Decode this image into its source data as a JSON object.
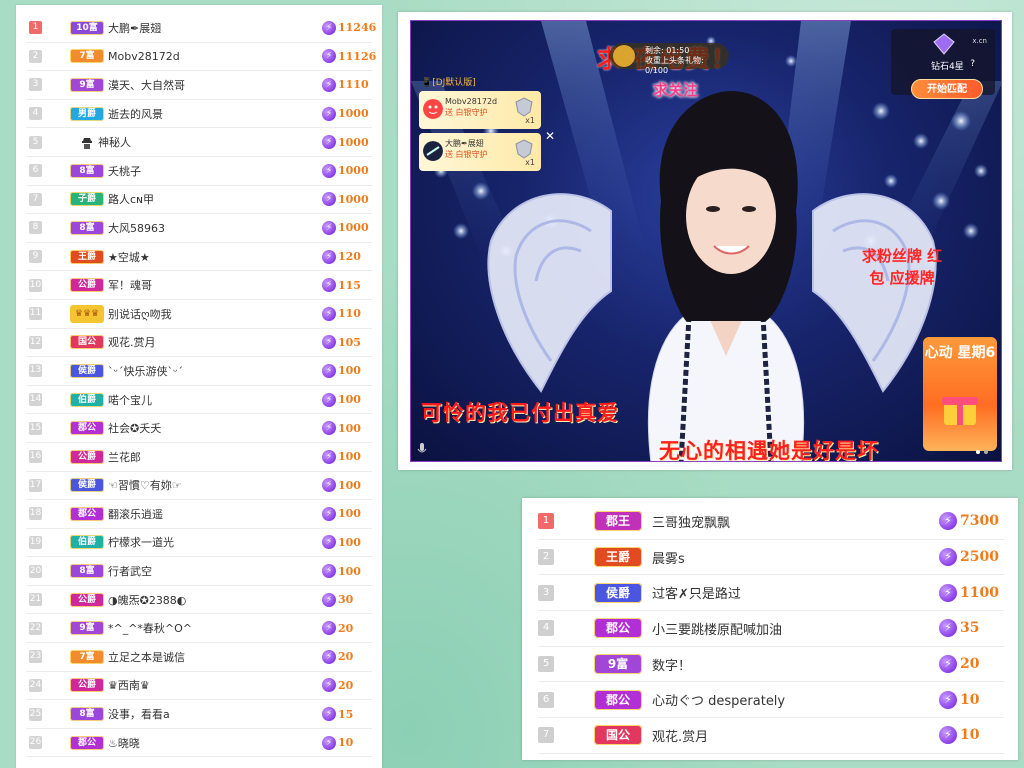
{
  "left_ranking": {
    "rows": [
      {
        "rank": "1",
        "badge": "10富",
        "badge_color": "#8a49d8",
        "name": "大鹏✒展翅",
        "value": "11246",
        "top": true
      },
      {
        "rank": "2",
        "badge": "7富",
        "badge_color": "#f28a2e",
        "name": "Mobv28172d",
        "value": "11126"
      },
      {
        "rank": "3",
        "badge": "9富",
        "badge_color": "#a246d8",
        "name": "漠天、大自然哥",
        "value": "1110"
      },
      {
        "rank": "4",
        "badge": "男爵",
        "badge_color": "#22a7e0",
        "name": "逝去的风景",
        "value": "1000"
      },
      {
        "rank": "5",
        "badge": "",
        "badge_color": "",
        "name": "神秘人",
        "value": "1000",
        "mystery": true
      },
      {
        "rank": "6",
        "badge": "8富",
        "badge_color": "#9b47dc",
        "name": "夭桃子",
        "value": "1000"
      },
      {
        "rank": "7",
        "badge": "子爵",
        "badge_color": "#27b37a",
        "name": "路人ᴄɴ甲",
        "value": "1000"
      },
      {
        "rank": "8",
        "badge": "8富",
        "badge_color": "#9b47dc",
        "name": "大风58963",
        "value": "1000"
      },
      {
        "rank": "9",
        "badge": "王爵",
        "badge_color": "#e24a1f",
        "name": "★空城★",
        "value": "120"
      },
      {
        "rank": "10",
        "badge": "公爵",
        "badge_color": "#d0289a",
        "name": "军！魂哥",
        "value": "115"
      },
      {
        "rank": "11",
        "badge": "",
        "badge_color": "",
        "name": "别说话ღ吻我",
        "value": "110",
        "crown": true
      },
      {
        "rank": "12",
        "badge": "国公",
        "badge_color": "#e23860",
        "name": "观花.赏月",
        "value": "105"
      },
      {
        "rank": "13",
        "badge": "侯爵",
        "badge_color": "#4a55e0",
        "name": "ˋᵕˊ快乐游侠ˋᵕˊ",
        "value": "100"
      },
      {
        "rank": "14",
        "badge": "伯爵",
        "badge_color": "#1fb0a8",
        "name": "喏个宝儿",
        "value": "100"
      },
      {
        "rank": "15",
        "badge": "郡公",
        "badge_color": "#b22fd6",
        "name": "社会✪夭夭",
        "value": "100"
      },
      {
        "rank": "16",
        "badge": "公爵",
        "badge_color": "#d0289a",
        "name": "兰花郎",
        "value": "100"
      },
      {
        "rank": "17",
        "badge": "侯爵",
        "badge_color": "#4a55e0",
        "name": "☜習慣♡有妳☞",
        "value": "100"
      },
      {
        "rank": "18",
        "badge": "郡公",
        "badge_color": "#b22fd6",
        "name": "翻滚乐逍遥",
        "value": "100"
      },
      {
        "rank": "19",
        "badge": "伯爵",
        "badge_color": "#1fb0a8",
        "name": "柠檬求一道光",
        "value": "100"
      },
      {
        "rank": "20",
        "badge": "8富",
        "badge_color": "#9b47dc",
        "name": "行者武空",
        "value": "100"
      },
      {
        "rank": "21",
        "badge": "公爵",
        "badge_color": "#d0289a",
        "name": "◑魄炁✪2388◐",
        "value": "30"
      },
      {
        "rank": "22",
        "badge": "9富",
        "badge_color": "#a246d8",
        "name": "*^_^*春秋^O^",
        "value": "20"
      },
      {
        "rank": "23",
        "badge": "7富",
        "badge_color": "#f28a2e",
        "name": "立足之本是诚信",
        "value": "20"
      },
      {
        "rank": "24",
        "badge": "公爵",
        "badge_color": "#d0289a",
        "name": "♛西南♛",
        "value": "20"
      },
      {
        "rank": "25",
        "badge": "8富",
        "badge_color": "#9b47dc",
        "name": "没事，看看a",
        "value": "15"
      },
      {
        "rank": "26",
        "badge": "郡公",
        "badge_color": "#b22fd6",
        "name": "♨晓晓",
        "value": "10"
      }
    ]
  },
  "stream": {
    "title_banner": "求   夜电费！",
    "timer_line1": "剩余: 01:50",
    "timer_line2": "收重上头条礼物: 0/100",
    "live_source": "📱[DJ默认版]",
    "gifts": [
      {
        "user": "Mobv28172d",
        "action": "送 白银守护",
        "count": "x1"
      },
      {
        "user": "大鹏✒展翅",
        "action": "送 白银守护",
        "count": "x1"
      }
    ],
    "close_glyph": "✕",
    "rank_label": "钻石4星",
    "rank_help": "?",
    "site_mark": "x.cn",
    "match_button": "开始匹配",
    "follow_tag": "求关注",
    "right_slogan": "求粉丝牌 红 包 应援牌",
    "promo_title": "心动 星期6",
    "subtitle_1": "可怜的我已付出真爱",
    "subtitle_2": "无心的相遇她是好是坏",
    "colors": {
      "subtitle": "#ff1b1b",
      "accent": "#ff7a26"
    }
  },
  "right_ranking": {
    "rows": [
      {
        "rank": "1",
        "badge": "郡王",
        "badge_color": "#c130b8",
        "name": "三哥独宠飘飘",
        "value": "7300",
        "top": true
      },
      {
        "rank": "2",
        "badge": "王爵",
        "badge_color": "#e24a1f",
        "name": "晨雾s",
        "value": "2500"
      },
      {
        "rank": "3",
        "badge": "侯爵",
        "badge_color": "#4a55e0",
        "name": "过客✗只是路过",
        "value": "1100"
      },
      {
        "rank": "4",
        "badge": "郡公",
        "badge_color": "#b22fd6",
        "name": "小三要跳楼原配喊加油",
        "value": "35"
      },
      {
        "rank": "5",
        "badge": "9富",
        "badge_color": "#a246d8",
        "name": "数字！",
        "value": "20"
      },
      {
        "rank": "6",
        "badge": "郡公",
        "badge_color": "#b22fd6",
        "name": "心动ぐつ desperately",
        "value": "10"
      },
      {
        "rank": "7",
        "badge": "国公",
        "badge_color": "#e23860",
        "name": "观花.赏月",
        "value": "10"
      }
    ]
  },
  "coin_glyph": "⚡"
}
